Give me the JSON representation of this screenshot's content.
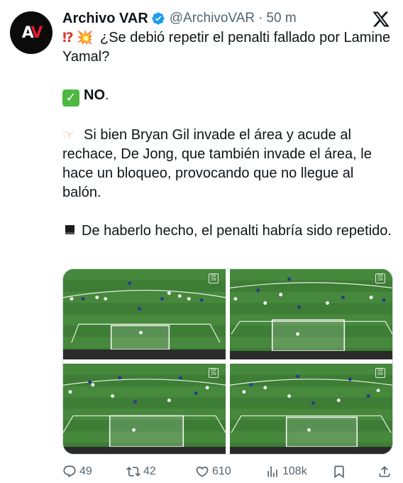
{
  "author": {
    "avatar_text_white": "A",
    "avatar_text_red": "V",
    "name": "Archivo VAR",
    "verified": true,
    "handle": "@ArchivoVAR",
    "separator": "·",
    "time": "50 m"
  },
  "tweet": {
    "line1_emoji_a": "⁉",
    "line1_emoji_b": "💥",
    "line1": "¿Se debió repetir el penalti fallado por Lamine Yamal?",
    "answer_check": "✓",
    "answer": "NO",
    "answer_tail": ".",
    "para2_emoji": "☞",
    "para2": "Si bien Bryan Gil invade el área y acude al rechace, De Jong, que también invade el área, le hace un bloqueo, provocando que no llegue al balón.",
    "para3": "De haberlo hecho, el penalti habría sido repetido."
  },
  "media": {
    "watermark": "DA ZN",
    "images": [
      "frame-1",
      "frame-2",
      "frame-3",
      "frame-4"
    ]
  },
  "actions": {
    "replies": "49",
    "reposts": "42",
    "likes": "610",
    "views": "108k"
  },
  "icons": {
    "close": "x-logo-icon",
    "reply": "reply-icon",
    "repost": "repost-icon",
    "like": "heart-icon",
    "views": "views-icon",
    "bookmark": "bookmark-icon",
    "share": "share-icon"
  },
  "colors": {
    "text": "#0f1419",
    "secondary": "#536471",
    "verified": "#1d9bf0",
    "pitch": "#3a7a33",
    "avatar_red": "#e0182d"
  }
}
